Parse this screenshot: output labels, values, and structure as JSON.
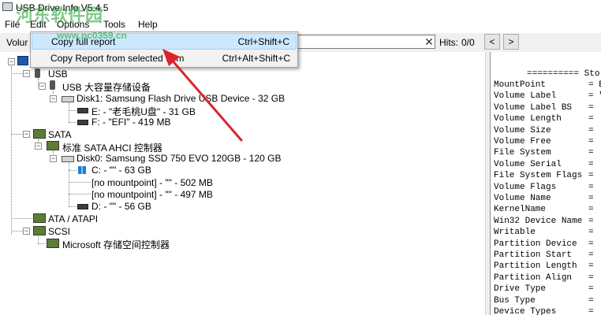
{
  "window": {
    "title": "USB Drive Info V5.4.5"
  },
  "menu": {
    "items": [
      "File",
      "Edit",
      "Options",
      "Tools",
      "Help"
    ]
  },
  "toolbar": {
    "volume_label": "Volur",
    "search_value": "",
    "hits_label": "Hits:",
    "hits_value": "0/0",
    "clear_glyph": "✕",
    "prev_glyph": "<",
    "next_glyph": ">"
  },
  "dropdown": {
    "items": [
      {
        "label": "Copy full report",
        "shortcut": "Ctrl+Shift+C"
      },
      {
        "label": "Copy Report from selected Item",
        "shortcut": "Ctrl+Alt+Shift+C"
      }
    ]
  },
  "tree": {
    "nodes": [
      {
        "label": "USB",
        "icon": "usb-icon"
      },
      {
        "label": "USB 大容量存储设备",
        "icon": "usb-device-icon"
      },
      {
        "label": "Disk1: Samsung Flash Drive USB Device - 32 GB",
        "icon": "disk-icon"
      },
      {
        "label": "E: - \"老毛桃U盘\" - 31 GB",
        "icon": "volume-icon"
      },
      {
        "label": "F: - \"EFI\" - 419 MB",
        "icon": "volume-icon"
      },
      {
        "label": "SATA",
        "icon": "controller-icon"
      },
      {
        "label": "标准 SATA AHCI 控制器",
        "icon": "controller-icon"
      },
      {
        "label": "Disk0: Samsung SSD 750 EVO 120GB - 120 GB",
        "icon": "disk-icon"
      },
      {
        "label": "C: - \"\" - 63 GB",
        "icon": "windows-volume-icon"
      },
      {
        "label": "[no mountpoint] - \"\" - 502 MB",
        "icon": ""
      },
      {
        "label": "[no mountpoint] - \"\" - 497 MB",
        "icon": ""
      },
      {
        "label": "D: - \"\" - 56 GB",
        "icon": "volume-icon"
      },
      {
        "label": "ATA / ATAPI",
        "icon": "controller-icon"
      },
      {
        "label": "SCSI",
        "icon": "controller-icon"
      },
      {
        "label": "Microsoft 存储空间控制器",
        "icon": "controller-icon"
      }
    ]
  },
  "report": {
    "header": "========== Sto",
    "fields": [
      {
        "key": "MountPoint",
        "value": "= E"
      },
      {
        "key": "Volume Label",
        "value": "= \""
      },
      {
        "key": "Volume Label BS",
        "value": "= "
      },
      {
        "key": "Volume Length",
        "value": "= "
      },
      {
        "key": "Volume Size",
        "value": "= "
      },
      {
        "key": "Volume Free",
        "value": "= "
      },
      {
        "key": "File System",
        "value": "= "
      },
      {
        "key": "Volume Serial",
        "value": "= "
      },
      {
        "key": "File System Flags",
        "value": "= "
      },
      {
        "key": "Volume Flags",
        "value": "= "
      },
      {
        "key": "Volume Name",
        "value": "= "
      },
      {
        "key": "KernelName",
        "value": "= "
      },
      {
        "key": "Win32 Device Name",
        "value": "= "
      },
      {
        "key": "Writable",
        "value": "= "
      },
      {
        "key": "Partition Device",
        "value": "= "
      },
      {
        "key": "Partition Start",
        "value": "= "
      },
      {
        "key": "Partition Length",
        "value": "= "
      },
      {
        "key": "Partition Align",
        "value": "= "
      },
      {
        "key": "Drive Type",
        "value": "= "
      },
      {
        "key": "Bus Type",
        "value": "= "
      },
      {
        "key": "Device Types",
        "value": "= "
      }
    ]
  },
  "watermark": {
    "text": "河东软件园",
    "url": "www.pc0359.cn"
  },
  "colors": {
    "menu_highlight": "#cce8ff",
    "annotation_arrow": "#d9262b"
  }
}
